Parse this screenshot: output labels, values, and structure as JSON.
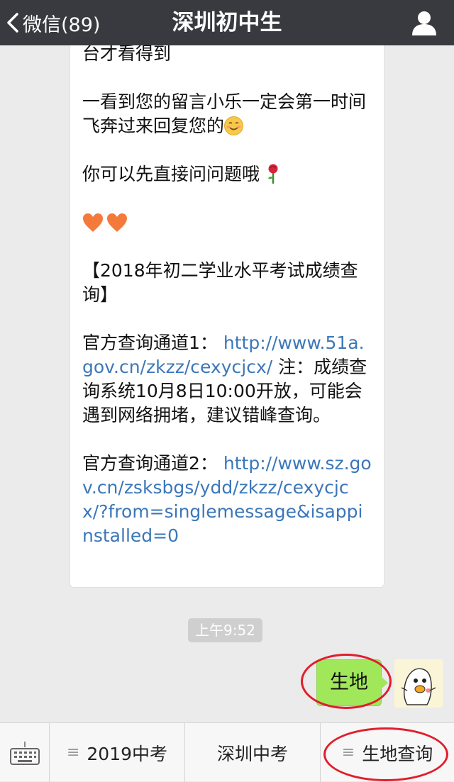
{
  "header": {
    "back_label": "微信(89)",
    "title": "深圳初中生",
    "profile_icon": "person-icon",
    "bg_color": "#393a3f"
  },
  "message": {
    "top_fragment": "台才看得到",
    "para1": "一看到您的留言小乐一定会第一时间飞奔过来回复您的",
    "para2": "你可以先直接问问题哦",
    "para3": "【2018年初二学业水平考试成绩查询】",
    "para4_prefix": "官方查询通道1：",
    "para4_link": "http://www.51a.gov.cn/zkzz/cexycjcx/",
    "para4_suffix": " 注：成绩查询系统10月8日10:00开放，可能会遇到网络拥堵，建议错峰查询。",
    "para5_prefix": "官方查询通道2：",
    "para5_link": "http://www.sz.gov.cn/zsksbgs/ydd/zkzz/cexycjcx/?from=singlemessage&isappinstalled=0",
    "link_color": "#3b77b9"
  },
  "timestamp": "上午9:52",
  "outgoing": {
    "text": "生地",
    "bubble_color": "#a0e75a"
  },
  "bottom_menu": {
    "keyboard_icon": "keyboard-icon",
    "items": [
      {
        "label": "2019中考",
        "has_submenu": true
      },
      {
        "label": "深圳中考",
        "has_submenu": false
      },
      {
        "label": "生地查询",
        "has_submenu": true
      }
    ],
    "menu_icon": "≡"
  },
  "annotation_color": "#e01e2b"
}
